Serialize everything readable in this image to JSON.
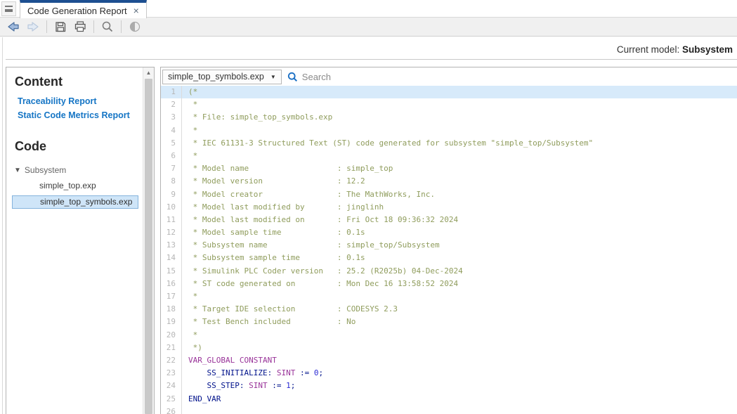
{
  "window": {
    "tab_title": "Code Generation Report",
    "tab_close_glyph": "×"
  },
  "toolbar": {
    "buttons": [
      {
        "name": "back",
        "icon": "arrow-left-icon",
        "enabled": true
      },
      {
        "name": "forward",
        "icon": "arrow-right-icon",
        "enabled": false
      },
      {
        "name": "save",
        "icon": "floppy-icon",
        "enabled": true
      },
      {
        "name": "print",
        "icon": "printer-icon",
        "enabled": true
      },
      {
        "name": "find",
        "icon": "magnifier-icon",
        "enabled": true
      },
      {
        "name": "contrast",
        "icon": "half-circle-icon",
        "enabled": true
      }
    ]
  },
  "header": {
    "current_model_label": "Current model:",
    "current_model_value": "Subsystem"
  },
  "sidebar": {
    "content_heading": "Content",
    "links": [
      "Traceability Report",
      "Static Code Metrics Report"
    ],
    "code_heading": "Code",
    "tree": {
      "caret_glyph": "▼",
      "root_label": "Subsystem",
      "children": [
        {
          "label": "simple_top.exp",
          "selected": false
        },
        {
          "label": "simple_top_symbols.exp",
          "selected": true
        }
      ]
    },
    "scroll_up_glyph": "▲"
  },
  "code_panel": {
    "file_dropdown_value": "simple_top_symbols.exp",
    "dropdown_arrow_glyph": "▼",
    "search_placeholder": "Search",
    "lines": [
      {
        "n": 1,
        "highlight": true,
        "segments": [
          {
            "text": "(*",
            "style": "comment"
          }
        ]
      },
      {
        "n": 2,
        "highlight": false,
        "segments": [
          {
            "text": " *",
            "style": "comment"
          }
        ]
      },
      {
        "n": 3,
        "highlight": false,
        "segments": [
          {
            "text": " * File: simple_top_symbols.exp",
            "style": "comment"
          }
        ]
      },
      {
        "n": 4,
        "highlight": false,
        "segments": [
          {
            "text": " *",
            "style": "comment"
          }
        ]
      },
      {
        "n": 5,
        "highlight": false,
        "segments": [
          {
            "text": " * IEC 61131-3 Structured Text (ST) code generated for subsystem \"simple_top/Subsystem\"",
            "style": "comment"
          }
        ]
      },
      {
        "n": 6,
        "highlight": false,
        "segments": [
          {
            "text": " *",
            "style": "comment"
          }
        ]
      },
      {
        "n": 7,
        "highlight": false,
        "segments": [
          {
            "text": " * Model name                   : simple_top",
            "style": "comment"
          }
        ]
      },
      {
        "n": 8,
        "highlight": false,
        "segments": [
          {
            "text": " * Model version                : 12.2",
            "style": "comment"
          }
        ]
      },
      {
        "n": 9,
        "highlight": false,
        "segments": [
          {
            "text": " * Model creator                : The MathWorks, Inc.",
            "style": "comment"
          }
        ]
      },
      {
        "n": 10,
        "highlight": false,
        "segments": [
          {
            "text": " * Model last modified by       : jinglinh",
            "style": "comment"
          }
        ]
      },
      {
        "n": 11,
        "highlight": false,
        "segments": [
          {
            "text": " * Model last modified on       : Fri Oct 18 09:36:32 2024",
            "style": "comment"
          }
        ]
      },
      {
        "n": 12,
        "highlight": false,
        "segments": [
          {
            "text": " * Model sample time            : 0.1s",
            "style": "comment"
          }
        ]
      },
      {
        "n": 13,
        "highlight": false,
        "segments": [
          {
            "text": " * Subsystem name               : simple_top/Subsystem",
            "style": "comment"
          }
        ]
      },
      {
        "n": 14,
        "highlight": false,
        "segments": [
          {
            "text": " * Subsystem sample time        : 0.1s",
            "style": "comment"
          }
        ]
      },
      {
        "n": 15,
        "highlight": false,
        "segments": [
          {
            "text": " * Simulink PLC Coder version   : 25.2 (R2025b) 04-Dec-2024",
            "style": "comment"
          }
        ]
      },
      {
        "n": 16,
        "highlight": false,
        "segments": [
          {
            "text": " * ST code generated on         : Mon Dec 16 13:58:52 2024",
            "style": "comment"
          }
        ]
      },
      {
        "n": 17,
        "highlight": false,
        "segments": [
          {
            "text": " *",
            "style": "comment"
          }
        ]
      },
      {
        "n": 18,
        "highlight": false,
        "segments": [
          {
            "text": " * Target IDE selection         : CODESYS 2.3",
            "style": "comment"
          }
        ]
      },
      {
        "n": 19,
        "highlight": false,
        "segments": [
          {
            "text": " * Test Bench included          : No",
            "style": "comment"
          }
        ]
      },
      {
        "n": 20,
        "highlight": false,
        "segments": [
          {
            "text": " *",
            "style": "comment"
          }
        ]
      },
      {
        "n": 21,
        "highlight": false,
        "segments": [
          {
            "text": " *)",
            "style": "comment"
          }
        ]
      },
      {
        "n": 22,
        "highlight": false,
        "segments": [
          {
            "text": "VAR_GLOBAL",
            "style": "keyword"
          },
          {
            "text": " ",
            "style": "plain"
          },
          {
            "text": "CONSTANT",
            "style": "keyword"
          }
        ]
      },
      {
        "n": 23,
        "highlight": false,
        "segments": [
          {
            "text": "    ",
            "style": "plain"
          },
          {
            "text": "SS_INITIALIZE:",
            "style": "identifier"
          },
          {
            "text": " ",
            "style": "plain"
          },
          {
            "text": "SINT",
            "style": "keyword"
          },
          {
            "text": " ",
            "style": "plain"
          },
          {
            "text": ":=",
            "style": "identifier"
          },
          {
            "text": " ",
            "style": "plain"
          },
          {
            "text": "0",
            "style": "number"
          },
          {
            "text": ";",
            "style": "identifier"
          }
        ]
      },
      {
        "n": 24,
        "highlight": false,
        "segments": [
          {
            "text": "    ",
            "style": "plain"
          },
          {
            "text": "SS_STEP:",
            "style": "identifier"
          },
          {
            "text": " ",
            "style": "plain"
          },
          {
            "text": "SINT",
            "style": "keyword"
          },
          {
            "text": " ",
            "style": "plain"
          },
          {
            "text": ":=",
            "style": "identifier"
          },
          {
            "text": " ",
            "style": "plain"
          },
          {
            "text": "1",
            "style": "number"
          },
          {
            "text": ";",
            "style": "identifier"
          }
        ]
      },
      {
        "n": 25,
        "highlight": false,
        "segments": [
          {
            "text": "END_VAR",
            "style": "identifier"
          }
        ]
      },
      {
        "n": 26,
        "highlight": false,
        "segments": []
      }
    ]
  },
  "colors": {
    "tab_accent": "#1d4f91",
    "link_blue": "#1575c5",
    "selected_item_bg": "#cfe5f8",
    "selected_item_border": "#84b3dd",
    "line_highlight_bg": "#d7eafa",
    "comment_green": "#8f9c5c",
    "keyword_purple": "#993399",
    "identifier_navy": "#00128b",
    "number_blue": "#2a2ad4",
    "search_icon_blue": "#1a6fc4"
  }
}
